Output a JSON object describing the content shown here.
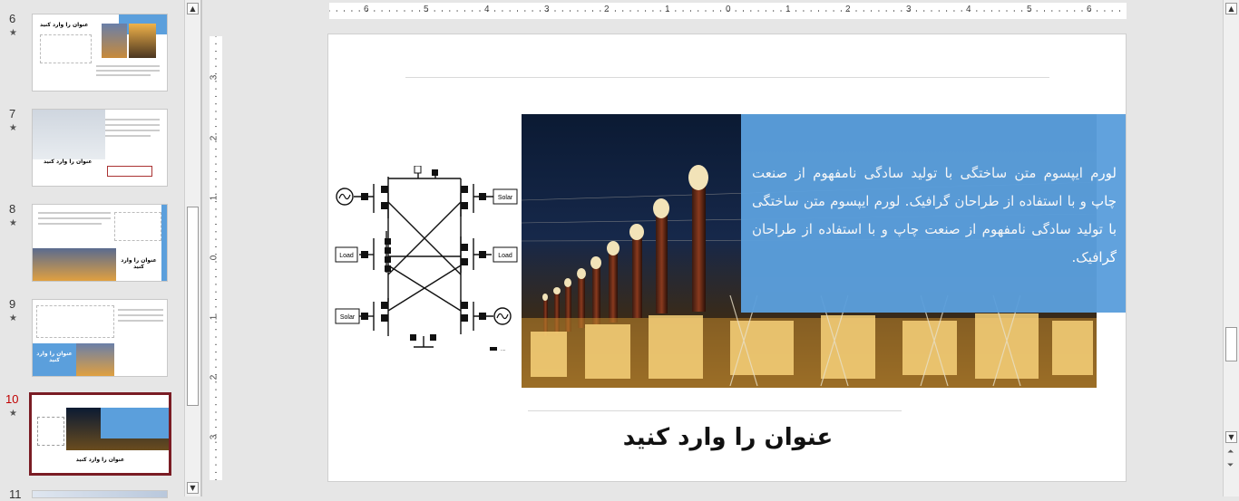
{
  "slides_pane": {
    "thumbnails": [
      {
        "number": "6",
        "title": "عنوان را وارد کنید"
      },
      {
        "number": "7",
        "title": "عنوان را وارد کنید"
      },
      {
        "number": "8",
        "title": "عنوان را وارد کنید"
      },
      {
        "number": "9",
        "title": "عنوان را وارد کنید"
      },
      {
        "number": "10",
        "title": "عنوان را وارد کنید",
        "selected": true
      },
      {
        "number": "11"
      }
    ],
    "star_glyph": "★"
  },
  "ruler": {
    "horizontal_labels": [
      "6",
      "5",
      "4",
      "3",
      "2",
      "1",
      "0",
      "1",
      "2",
      "3",
      "4",
      "5",
      "6"
    ],
    "vertical_labels": [
      "3",
      "2",
      "1",
      "0",
      "1",
      "2",
      "3"
    ]
  },
  "slide": {
    "body_text": "لورم ایپسوم متن ساختگی با تولید سادگی نامفهوم از صنعت چاپ و با استفاده از طراحان گرافیک. لورم ایپسوم متن ساختگی با تولید سادگی نامفهوم از صنعت چاپ و با استفاده از طراحان گرافیک.",
    "title": "عنوان را وارد کنید",
    "diagram_labels": {
      "solar_top": "Solar",
      "load_left": "Load",
      "load_right": "Load",
      "solar_bottom": "Solar",
      "legend": "...."
    }
  },
  "colors": {
    "accent_blue": "#5b9fdc",
    "selection_border": "#7a1c24",
    "selected_number": "#c00000"
  }
}
